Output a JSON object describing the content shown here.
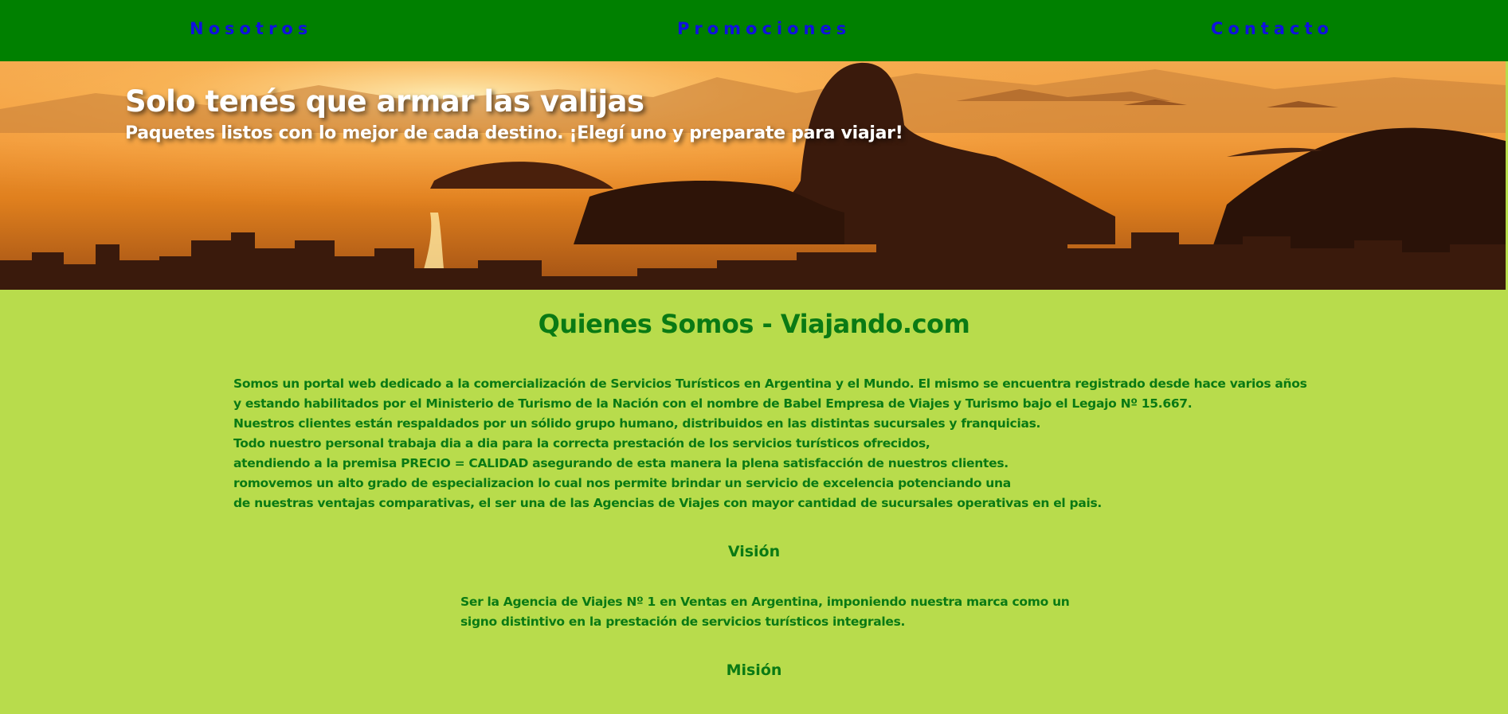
{
  "nav": {
    "items": [
      {
        "label": "Nosotros"
      },
      {
        "label": "Promociones"
      },
      {
        "label": "Contacto"
      }
    ],
    "background": "#008000",
    "link_color": "#1010e0"
  },
  "hero": {
    "title": "Solo tenés que armar las valijas",
    "subtitle": "Paquetes listos con lo mejor de cada destino. ¡Elegí uno y preparate para viajar!"
  },
  "main": {
    "title": "Quienes Somos - Viajando.com",
    "about_lines": [
      "Somos un portal web dedicado a la comercialización de Servicios Turísticos en Argentina y el Mundo. El mismo se encuentra registrado desde hace varios años",
      "y estando habilitados por el Ministerio de Turismo de la Nación con el nombre de Babel Empresa de Viajes y Turismo bajo el Legajo Nº 15.667.",
      "Nuestros clientes están respaldados por un sólido grupo humano, distribuidos en las distintas sucursales y franquicias.",
      "Todo nuestro personal trabaja dia a dia para la correcta prestación de los servicios turísticos ofrecidos,",
      "atendiendo a la premisa PRECIO = CALIDAD asegurando de esta manera la plena satisfacción de nuestros clientes.",
      "romovemos un alto grado de especializacion lo cual nos permite brindar un servicio de excelencia potenciando una",
      "de nuestras ventajas comparativas, el ser una de las Agencias de Viajes con mayor cantidad de sucursales operativas en el pais."
    ],
    "vision": {
      "title": "Visión",
      "lines": [
        "Ser la Agencia de Viajes Nº 1 en Ventas en Argentina, imponiendo nuestra marca como un",
        "signo distintivo en la prestación de servicios turísticos integrales."
      ]
    },
    "mission": {
      "title": "Misión"
    },
    "background": "#b8dc4c",
    "text_color": "#0a7a14"
  }
}
